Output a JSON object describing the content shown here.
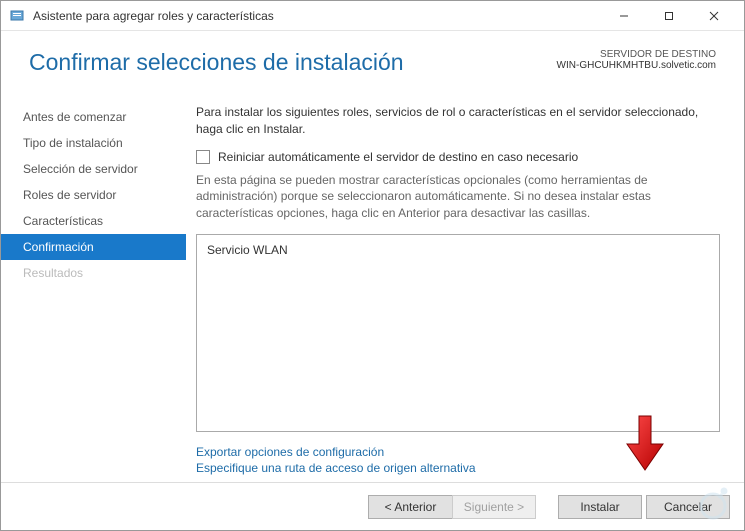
{
  "titlebar": {
    "title": "Asistente para agregar roles y características"
  },
  "header": {
    "title": "Confirmar selecciones de instalación",
    "server_label": "SERVIDOR DE DESTINO",
    "server_name": "WIN-GHCUHKMHTBU.solvetic.com"
  },
  "sidebar": {
    "steps": [
      {
        "label": "Antes de comenzar",
        "state": "past"
      },
      {
        "label": "Tipo de instalación",
        "state": "past"
      },
      {
        "label": "Selección de servidor",
        "state": "past"
      },
      {
        "label": "Roles de servidor",
        "state": "past"
      },
      {
        "label": "Características",
        "state": "past"
      },
      {
        "label": "Confirmación",
        "state": "active"
      },
      {
        "label": "Resultados",
        "state": "future"
      }
    ]
  },
  "content": {
    "intro": "Para instalar los siguientes roles, servicios de rol o características en el servidor seleccionado, haga clic en Instalar.",
    "restart_checkbox_label": "Reiniciar automáticamente el servidor de destino en caso necesario",
    "restart_checked": false,
    "note": "En esta página se pueden mostrar características opcionales (como herramientas de administración) porque se seleccionaron automáticamente. Si no desea instalar estas características opciones, haga clic en Anterior para desactivar las casillas.",
    "selected_items": [
      "Servicio WLAN"
    ],
    "link_export": "Exportar opciones de configuración",
    "link_altsource": "Especifique una ruta de acceso de origen alternativa"
  },
  "footer": {
    "previous": "< Anterior",
    "next": "Siguiente >",
    "install": "Instalar",
    "cancel": "Cancelar"
  },
  "colors": {
    "accent": "#1979ca",
    "heading": "#1e6ca8",
    "arrow": "#d62222"
  }
}
